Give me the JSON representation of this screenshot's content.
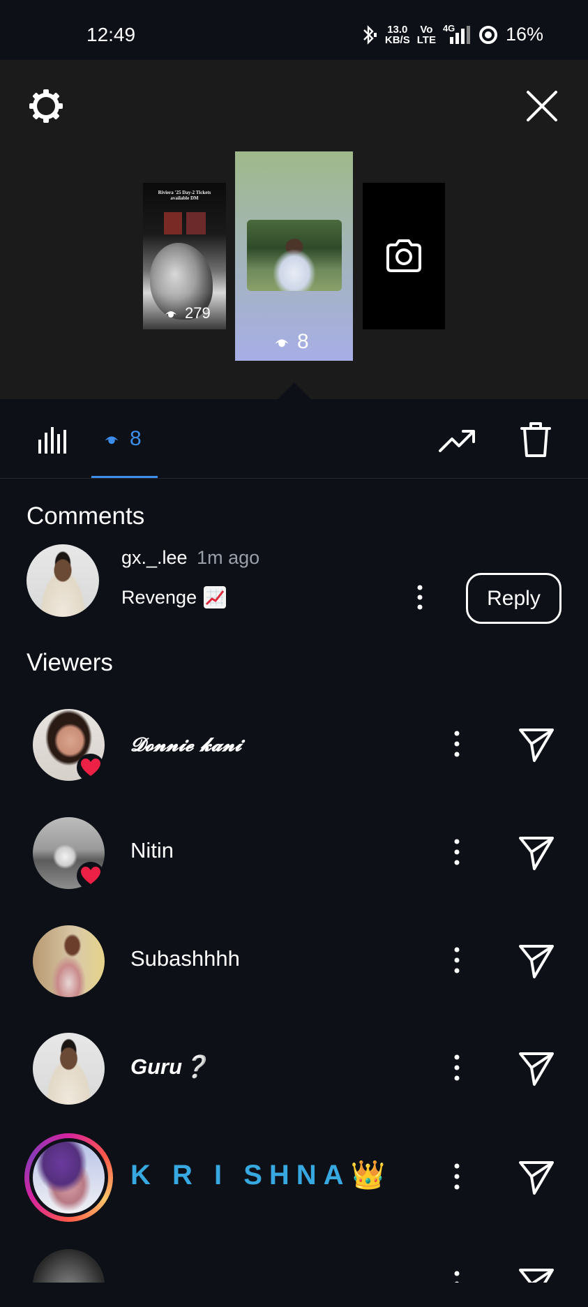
{
  "status_bar": {
    "time": "12:49",
    "net_speed_value": "13.0",
    "net_speed_unit": "KB/S",
    "volte_top": "Vo",
    "volte_bottom": "LTE",
    "network": "4G",
    "battery": "16%"
  },
  "story": {
    "thumbnails": [
      {
        "kind": "poster",
        "poster_text": "Riviera '25 Day-2 Tickets available DM",
        "views": "279"
      },
      {
        "kind": "photo",
        "views": "8",
        "selected": true
      },
      {
        "kind": "add-camera"
      }
    ]
  },
  "tabs": {
    "viewers_count": "8"
  },
  "comments": {
    "heading": "Comments",
    "items": [
      {
        "username": "gx._.lee",
        "time": "1m ago",
        "text": "Revenge",
        "emoji": "chart-increasing"
      }
    ],
    "reply_label": "Reply"
  },
  "viewers": {
    "heading": "Viewers",
    "items": [
      {
        "name": "𝓓𝓸𝓷𝓷𝓲𝓮 𝓴𝓪𝓷𝓲",
        "liked": true
      },
      {
        "name": "Nitin",
        "liked": true
      },
      {
        "name": "Subashhhh",
        "liked": false
      },
      {
        "name": "Guru❔",
        "liked": false
      },
      {
        "name": "K R I SHNA👑",
        "liked": false,
        "story_ring": true
      }
    ]
  },
  "colors": {
    "background": "#0d1017",
    "story_panel": "#1b1b1b",
    "accent_blue": "#3d8dea",
    "heart_red": "#ed2146",
    "krishna_cyan": "#37a9e0"
  }
}
